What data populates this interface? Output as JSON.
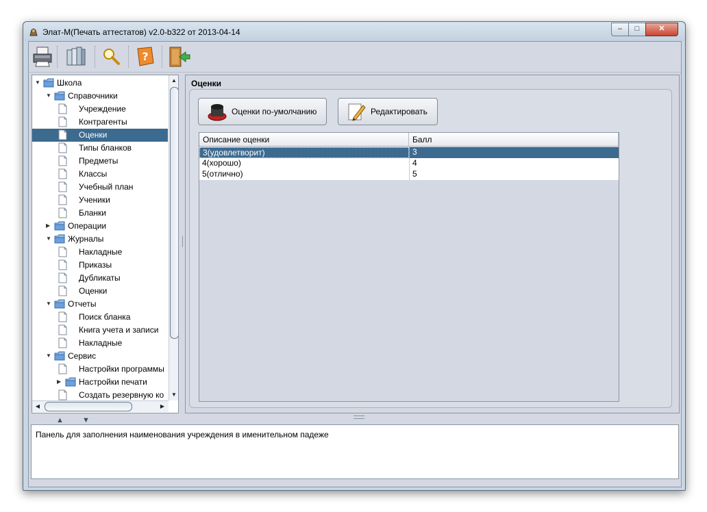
{
  "window": {
    "title": "Элат-М(Печать аттестатов) v2.0-b322 от 2013-04-14",
    "controls": {
      "minimize": "–",
      "maximize": "□",
      "close": "✕"
    }
  },
  "toolbar": {
    "buttons": [
      {
        "icon": "printer-icon"
      },
      {
        "icon": "documents-icon"
      },
      {
        "icon": "search-icon"
      },
      {
        "icon": "help-book-icon"
      },
      {
        "icon": "exit-door-icon"
      }
    ]
  },
  "tree": {
    "items": [
      {
        "label": "Школа",
        "type": "folder",
        "expanded": true
      },
      {
        "label": "Справочники",
        "type": "folder",
        "expanded": true
      },
      {
        "label": "Учреждение",
        "type": "document"
      },
      {
        "label": "Контрагенты",
        "type": "document"
      },
      {
        "label": "Оценки",
        "type": "document",
        "selected": true
      },
      {
        "label": "Типы бланков",
        "type": "document"
      },
      {
        "label": "Предметы",
        "type": "document"
      },
      {
        "label": "Классы",
        "type": "document"
      },
      {
        "label": "Учебный план",
        "type": "document"
      },
      {
        "label": "Ученики",
        "type": "document"
      },
      {
        "label": "Бланки",
        "type": "document"
      },
      {
        "label": "Операции",
        "type": "folder",
        "expanded": false
      },
      {
        "label": "Журналы",
        "type": "folder",
        "expanded": true
      },
      {
        "label": "Накладные",
        "type": "document"
      },
      {
        "label": "Приказы",
        "type": "document"
      },
      {
        "label": "Дубликаты",
        "type": "document"
      },
      {
        "label": "Оценки",
        "type": "document"
      },
      {
        "label": "Отчеты",
        "type": "folder",
        "expanded": true
      },
      {
        "label": "Поиск бланка",
        "type": "document"
      },
      {
        "label": "Книга учета и записи",
        "type": "document"
      },
      {
        "label": "Накладные",
        "type": "document"
      },
      {
        "label": "Сервис",
        "type": "folder",
        "expanded": true
      },
      {
        "label": "Настройки программы",
        "type": "document"
      },
      {
        "label": "Настройки печати",
        "type": "folder",
        "expanded": false
      },
      {
        "label": "Создать резервную ко",
        "type": "document"
      }
    ]
  },
  "content": {
    "title": "Оценки",
    "buttons": {
      "default_grades": "Оценки по-умолчанию",
      "edit": "Редактировать"
    },
    "table": {
      "columns": [
        "Описание оценки",
        "Балл"
      ],
      "rows": [
        {
          "description": "3(удовлетворит)",
          "score": "3",
          "selected": true
        },
        {
          "description": "4(хорошо)",
          "score": "4"
        },
        {
          "description": "5(отлично)",
          "score": "5"
        }
      ]
    }
  },
  "status": {
    "text": "Панель для заполнения наименования учреждения в именительном падеже"
  },
  "colors": {
    "selection": "#3d6a8f",
    "panel": "#d4d8e2",
    "frame": "#c9d6e3",
    "folder": "#5a8fd0"
  }
}
